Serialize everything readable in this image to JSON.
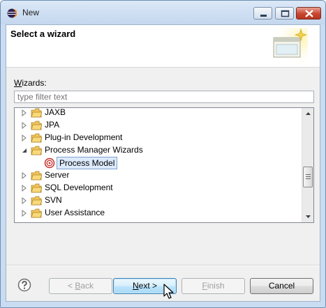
{
  "window": {
    "title": "New"
  },
  "header": {
    "title": "Select a wizard"
  },
  "wizards_label": "Wizards:",
  "filter": {
    "value": "",
    "placeholder": "type filter text"
  },
  "tree": {
    "items": [
      {
        "label": "JAXB",
        "expanded": false
      },
      {
        "label": "JPA",
        "expanded": false
      },
      {
        "label": "Plug-in Development",
        "expanded": false
      },
      {
        "label": "Process Manager Wizards",
        "expanded": true
      },
      {
        "label": "Process Model",
        "child": true,
        "selected": true
      },
      {
        "label": "Server",
        "expanded": false
      },
      {
        "label": "SQL Development",
        "expanded": false
      },
      {
        "label": "SVN",
        "expanded": false
      },
      {
        "label": "User Assistance",
        "expanded": false
      }
    ]
  },
  "buttons": {
    "back": {
      "pre": "< ",
      "mnemonic": "B",
      "post": "ack"
    },
    "next": {
      "mnemonic": "N",
      "post": "ext >"
    },
    "finish": {
      "mnemonic": "F",
      "post": "inish"
    },
    "cancel": "Cancel"
  },
  "colors": {
    "selection": "#dceafc",
    "default_button": "#bee6fd",
    "folder": "#e8b84a"
  }
}
